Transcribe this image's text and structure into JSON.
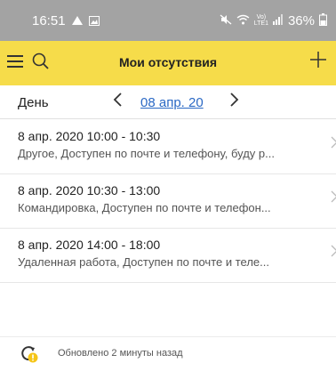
{
  "status_bar": {
    "time": "16:51",
    "network_label_top": "Vo)",
    "network_label_bottom": "LTE1",
    "battery_percent": "36%"
  },
  "app_bar": {
    "title": "Мои отсутствия",
    "menu_icon": "hamburger-icon",
    "search_icon": "search-icon",
    "add_icon": "plus-icon",
    "background_color": "#f6dc4a"
  },
  "period": {
    "label": "День",
    "prev_icon": "chevron-left-icon",
    "next_icon": "chevron-right-icon",
    "date": "08 апр. 20"
  },
  "items": [
    {
      "title": "8 апр. 2020 10:00 - 10:30",
      "description": "Другое, Доступен по почте и телефону, буду р..."
    },
    {
      "title": "8 апр. 2020 10:30 - 13:00",
      "description": "Командировка, Доступен по почте и телефон..."
    },
    {
      "title": "8 апр. 2020 14:00 - 18:00",
      "description": "Удаленная работа, Доступен по почте и теле..."
    }
  ],
  "footer": {
    "text": "Обновлено 2 минуты назад",
    "icon": "refresh-warning-icon"
  },
  "colors": {
    "link": "#2b69c5",
    "status_bar": "#a3a3a3",
    "warning": "#f5c518"
  }
}
